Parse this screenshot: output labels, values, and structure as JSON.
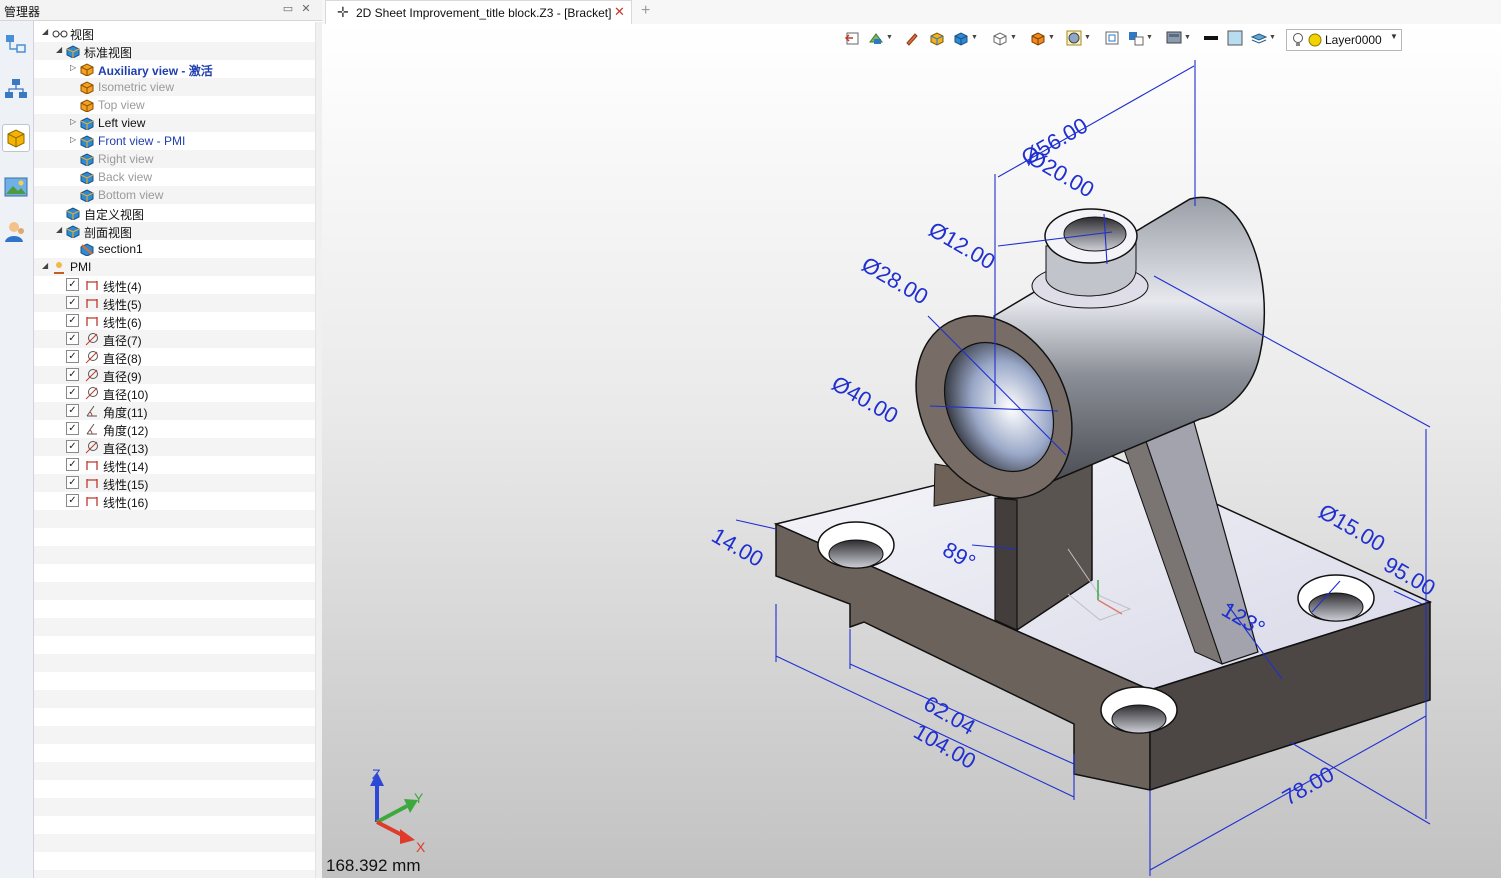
{
  "manager": {
    "title": "管理器",
    "pin_icon": "pin-icon",
    "close_icon": "close-icon",
    "side_icons": [
      "tree-icon",
      "hierarchy-icon",
      "view-cube-icon",
      "image-icon",
      "user-icon"
    ]
  },
  "tree": [
    {
      "label": "视图",
      "style": "normal",
      "level": 0,
      "expander": "▲",
      "icon": "glasses-icon",
      "indent": 8
    },
    {
      "label": "标准视图",
      "style": "normal",
      "level": 1,
      "expander": "▲",
      "icon": "view-icon",
      "indent": 22
    },
    {
      "label": "Auxiliary view - 激活",
      "style": "bold",
      "level": 2,
      "expander": "▷",
      "icon": "view-orange-icon",
      "indent": 36
    },
    {
      "label": "Isometric view",
      "style": "grey",
      "level": 2,
      "expander": "",
      "icon": "view-orange-icon",
      "indent": 36
    },
    {
      "label": "Top view",
      "style": "grey",
      "level": 2,
      "expander": "",
      "icon": "view-orange-icon",
      "indent": 36
    },
    {
      "label": "Left view",
      "style": "normal",
      "level": 2,
      "expander": "▷",
      "icon": "view-icon",
      "indent": 36
    },
    {
      "label": "Front view - PMI",
      "style": "blue",
      "level": 2,
      "expander": "▷",
      "icon": "view-icon",
      "indent": 36
    },
    {
      "label": "Right view",
      "style": "grey",
      "level": 2,
      "expander": "",
      "icon": "view-icon",
      "indent": 36
    },
    {
      "label": "Back view",
      "style": "grey",
      "level": 2,
      "expander": "",
      "icon": "view-icon",
      "indent": 36
    },
    {
      "label": "Bottom view",
      "style": "grey",
      "level": 2,
      "expander": "",
      "icon": "view-icon",
      "indent": 36
    },
    {
      "label": "自定义视图",
      "style": "normal",
      "level": 1,
      "expander": "",
      "icon": "view-icon",
      "indent": 22
    },
    {
      "label": "剖面视图",
      "style": "normal",
      "level": 1,
      "expander": "▲",
      "icon": "view-icon",
      "indent": 22
    },
    {
      "label": "section1",
      "style": "normal",
      "level": 2,
      "expander": "",
      "icon": "section-icon",
      "indent": 36
    },
    {
      "label": "PMI",
      "style": "normal",
      "level": 0,
      "expander": "▲",
      "icon": "pmi-icon",
      "indent": 8
    }
  ],
  "pmi_items": [
    {
      "label": "线性(4)",
      "icon": "linear-dim-icon",
      "checked": true
    },
    {
      "label": "线性(5)",
      "icon": "linear-dim-icon",
      "checked": true
    },
    {
      "label": "线性(6)",
      "icon": "linear-dim-icon",
      "checked": true
    },
    {
      "label": "直径(7)",
      "icon": "diameter-dim-icon",
      "checked": true
    },
    {
      "label": "直径(8)",
      "icon": "diameter-dim-icon",
      "checked": true
    },
    {
      "label": "直径(9)",
      "icon": "diameter-dim-icon",
      "checked": true
    },
    {
      "label": "直径(10)",
      "icon": "diameter-dim-icon",
      "checked": true
    },
    {
      "label": "角度(11)",
      "icon": "angle-dim-icon",
      "checked": true
    },
    {
      "label": "角度(12)",
      "icon": "angle-dim-icon",
      "checked": true
    },
    {
      "label": "直径(13)",
      "icon": "diameter-dim-icon",
      "checked": true
    },
    {
      "label": "线性(14)",
      "icon": "linear-dim-icon",
      "checked": true
    },
    {
      "label": "线性(15)",
      "icon": "linear-dim-icon",
      "checked": true
    },
    {
      "label": "线性(16)",
      "icon": "linear-dim-icon",
      "checked": true
    }
  ],
  "tabs": {
    "document_title": "2D Sheet Improvement_title block.Z3 - [Bracket]",
    "close_glyph": "✕",
    "new_tab_glyph": "+"
  },
  "toolbar": {
    "icons": [
      "undo-view-icon",
      "render-mode-icon",
      "pencil-icon",
      "box-shade-icon",
      "box-blue-icon",
      "box-outline-icon",
      "box-orange-icon",
      "sphere-icon",
      "frame-icon",
      "view-orient-icon",
      "display-icon",
      "line-weight-icon",
      "color-swatch-icon",
      "layers-icon"
    ],
    "layer_name": "Layer0000",
    "layer_icons": [
      "bulb-icon",
      "layer-color-icon"
    ]
  },
  "dimensions": {
    "d56": "Ø56.00",
    "d20": "Ø20.00",
    "d12": "Ø12.00",
    "d28": "Ø28.00",
    "d40": "Ø40.00",
    "d15": "Ø15.00",
    "l14": "14.00",
    "a89": "89°",
    "a123": "123°",
    "l62": "62.04",
    "l104": "104.00",
    "l78": "78.00",
    "l95": "95.00"
  },
  "triad": {
    "x": "X",
    "y": "Y",
    "z": "Z"
  },
  "scale_text": "168.392 mm",
  "colors": {
    "dimension": "#1f2fd0",
    "body_dark": "#6a625c",
    "body_light": "#f0f0f4"
  }
}
